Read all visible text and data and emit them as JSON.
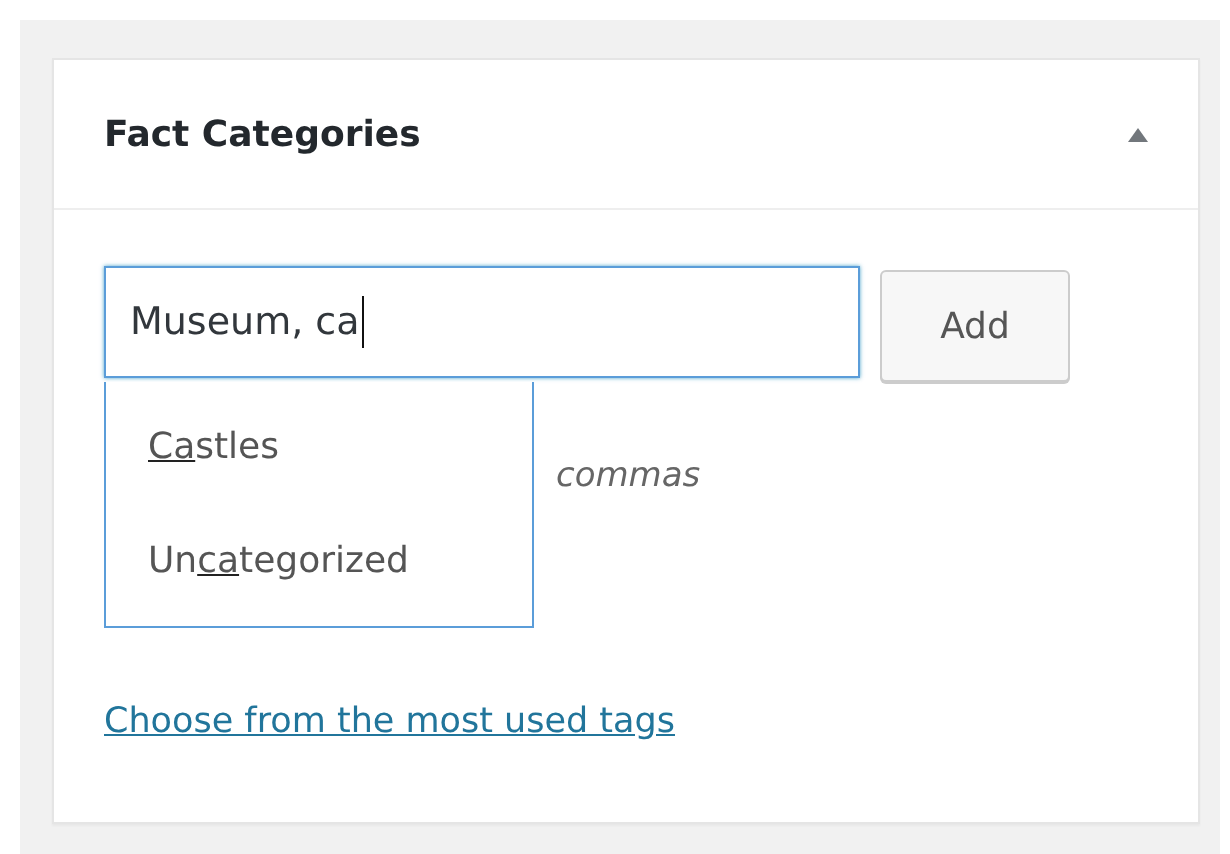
{
  "panel": {
    "title": "Fact Categories",
    "expanded": true
  },
  "tag_input": {
    "value": "Museum, ca",
    "focused": true
  },
  "add_button": "Add",
  "suggestions": [
    {
      "match": "Ca",
      "after": "stles"
    },
    {
      "before": "Un",
      "match": "ca",
      "after": "tegorized"
    }
  ],
  "hint_visible": "commas",
  "link": "Choose from the most used tags"
}
